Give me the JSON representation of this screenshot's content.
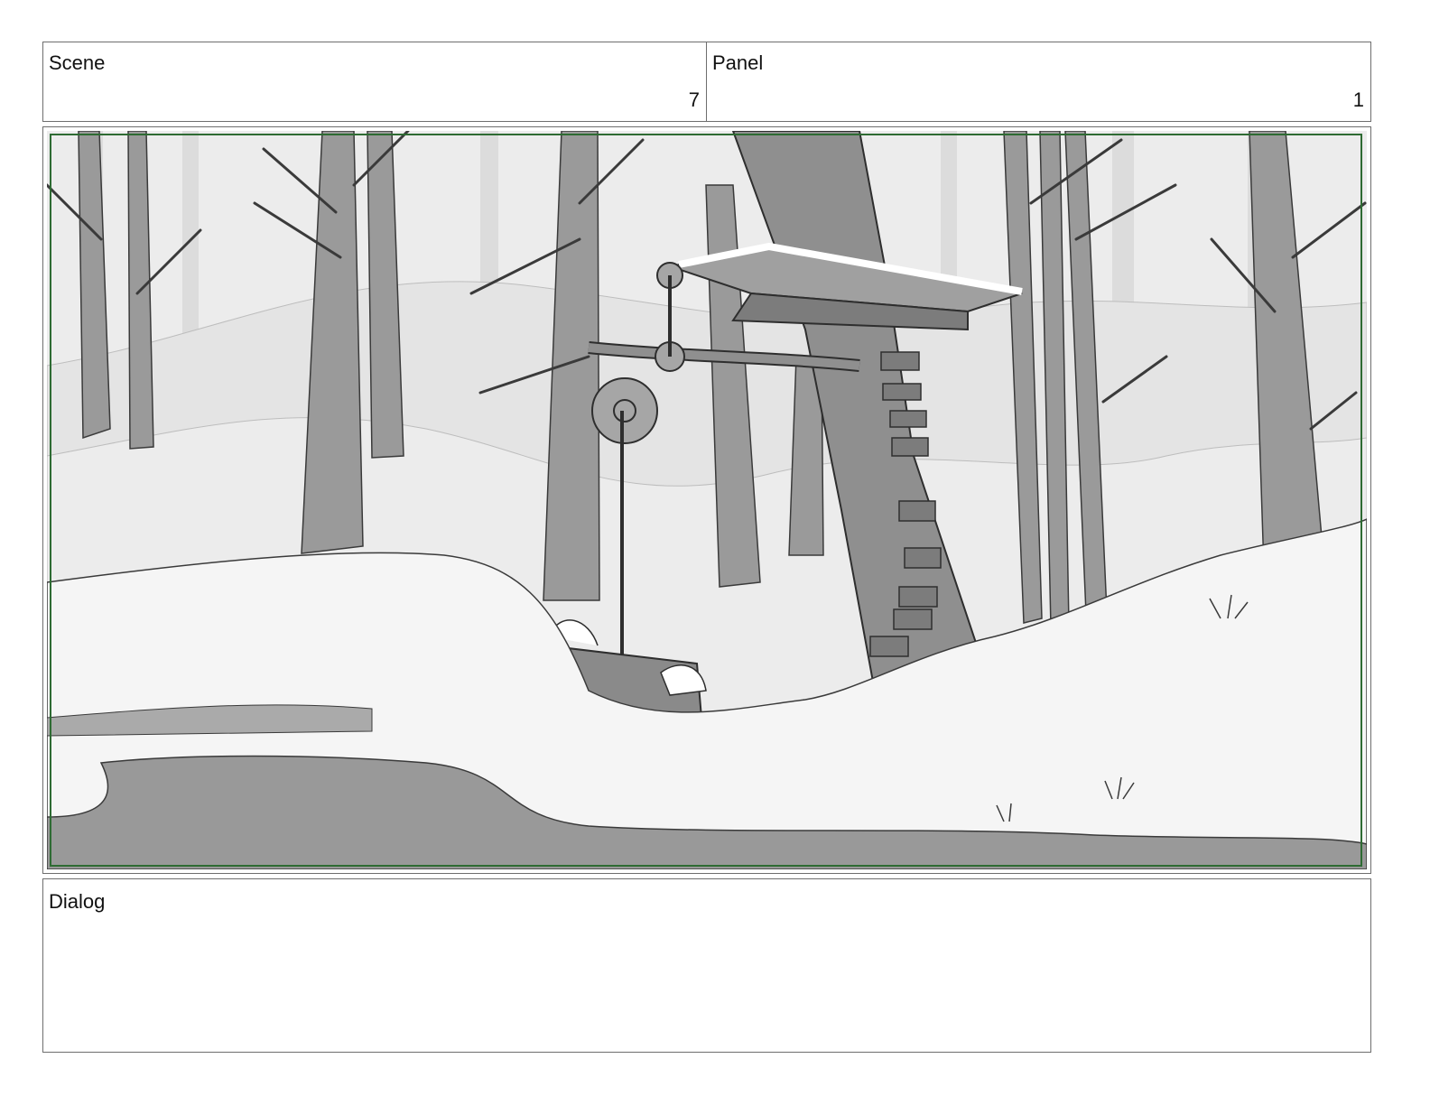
{
  "header": {
    "scene_label": "Scene",
    "scene_number": "7",
    "panel_label": "Panel",
    "panel_number": "1"
  },
  "frame": {
    "artwork_icon": "snowy-forest-treehouse-drawing",
    "safe_area_color": "#2e6b33"
  },
  "dialog": {
    "label": "Dialog",
    "text": ""
  }
}
